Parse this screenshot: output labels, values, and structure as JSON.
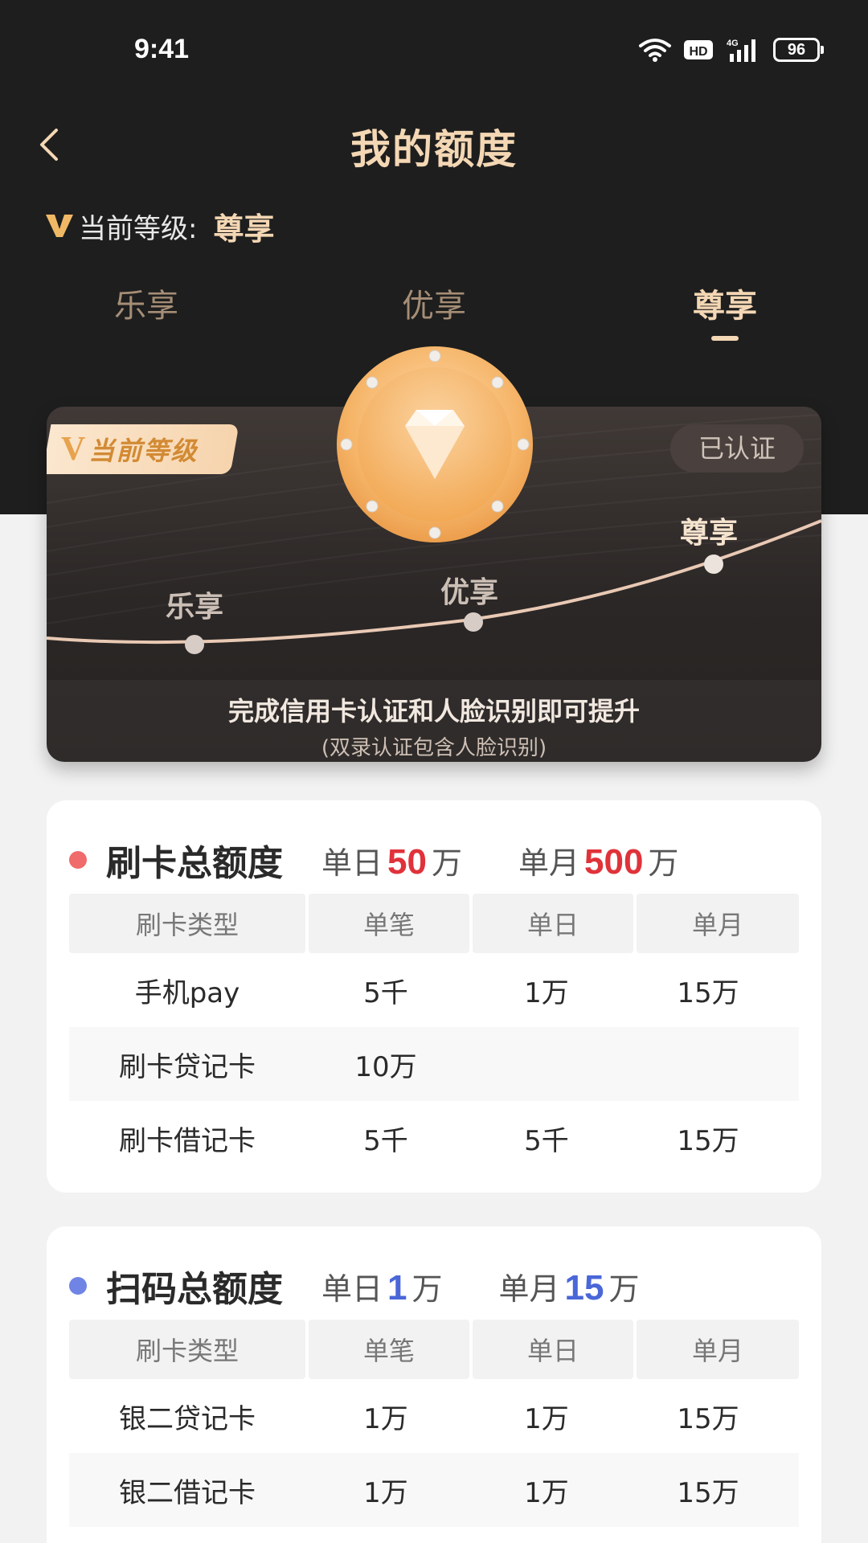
{
  "status_bar": {
    "time": "9:41",
    "battery": "96",
    "network": "4G"
  },
  "header": {
    "title": "我的额度",
    "level_label": "当前等级:",
    "level_value": "尊享"
  },
  "tabs": [
    {
      "label": "乐享",
      "active": false
    },
    {
      "label": "优享",
      "active": false
    },
    {
      "label": "尊享",
      "active": true
    }
  ],
  "level_card": {
    "badge": "当前等级",
    "badge_v": "V",
    "verified": "已认证",
    "points": [
      "乐享",
      "优享",
      "尊享"
    ],
    "footer_line1": "完成信用卡认证和人脸识别即可提升",
    "footer_line2": "(双录认证包含人脸识别)"
  },
  "card_limit": {
    "title": "刷卡总额度",
    "daily_prefix": "单日",
    "daily_value": "50",
    "daily_unit": "万",
    "monthly_prefix": "单月",
    "monthly_value": "500",
    "monthly_unit": "万",
    "accent": "#e0323a",
    "dot_color": "#f06b6b",
    "columns": [
      "刷卡类型",
      "单笔",
      "单日",
      "单月"
    ],
    "rows": [
      [
        "手机pay",
        "5千",
        "1万",
        "15万"
      ],
      [
        "刷卡贷记卡",
        "10万",
        "",
        ""
      ],
      [
        "刷卡借记卡",
        "5千",
        "5千",
        "15万"
      ]
    ]
  },
  "scan_limit": {
    "title": "扫码总额度",
    "daily_prefix": "单日",
    "daily_value": "1",
    "daily_unit": "万",
    "monthly_prefix": "单月",
    "monthly_value": "15",
    "monthly_unit": "万",
    "accent": "#4a67d8",
    "dot_color": "#6f84e4",
    "columns": [
      "刷卡类型",
      "单笔",
      "单日",
      "单月"
    ],
    "rows": [
      [
        "银二贷记卡",
        "1万",
        "1万",
        "15万"
      ],
      [
        "银二借记卡",
        "1万",
        "1万",
        "15万"
      ]
    ]
  },
  "icons": [
    "back-icon",
    "wifi-icon",
    "hd-icon",
    "signal-icon",
    "battery-icon",
    "diamond-icon",
    "v-icon"
  ],
  "colors": {
    "gold": "#f4d7b4",
    "dark_bg": "#1e1e1e"
  }
}
